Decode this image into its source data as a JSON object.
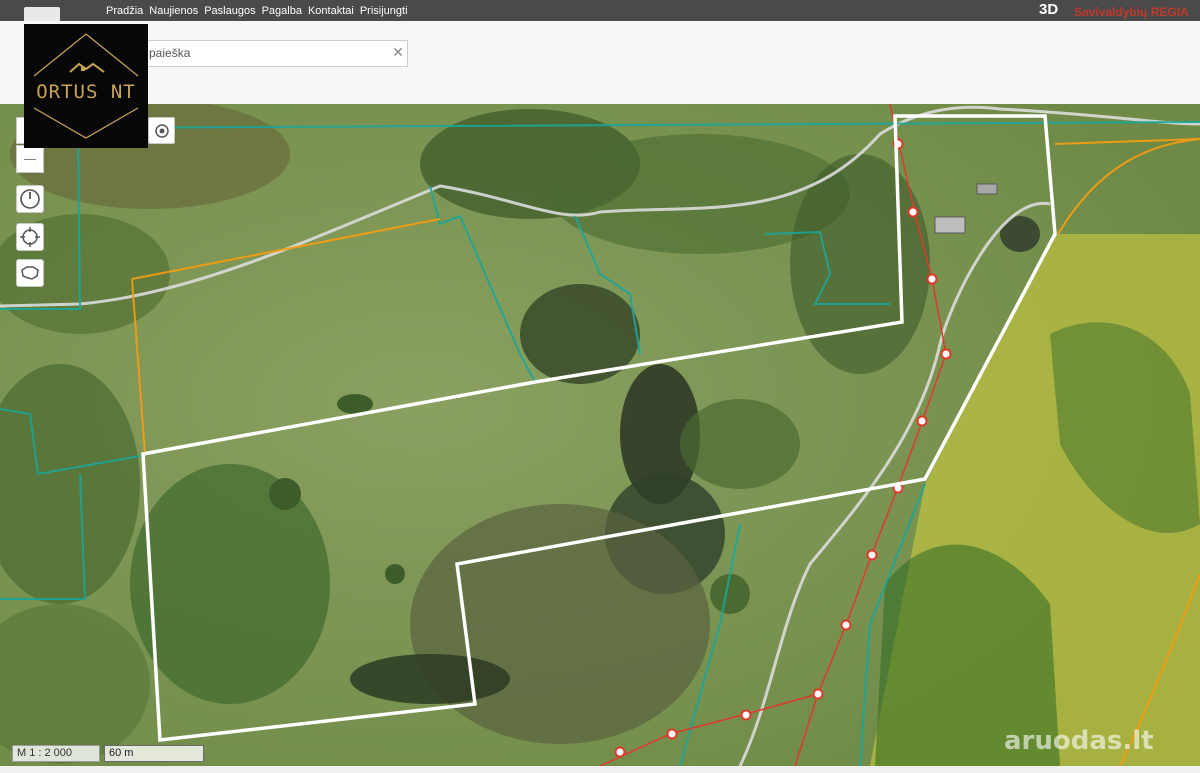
{
  "nav": {
    "items": [
      "Pradžia",
      "Naujienos",
      "Paslaugos",
      "Pagalba",
      "Kontaktai",
      "Prisijungti"
    ],
    "label_3d": "3D",
    "label_regia": "Savivaldybių REGIA"
  },
  "search": {
    "value": "paieška"
  },
  "brand": {
    "name": "ORTUS NT"
  },
  "controls": {
    "zoom_in": "+",
    "zoom_out": "—"
  },
  "scale": {
    "ratio": "M 1 : 2 000",
    "bar": "60 m"
  },
  "watermark": "aruodas.lt",
  "colors": {
    "plot_outline": "#ffffff",
    "cadastre_line": "#1aa69a",
    "boundary_line": "#f39c12",
    "power_line": "#e0392b",
    "forest_overlay": "#e8e13a"
  }
}
